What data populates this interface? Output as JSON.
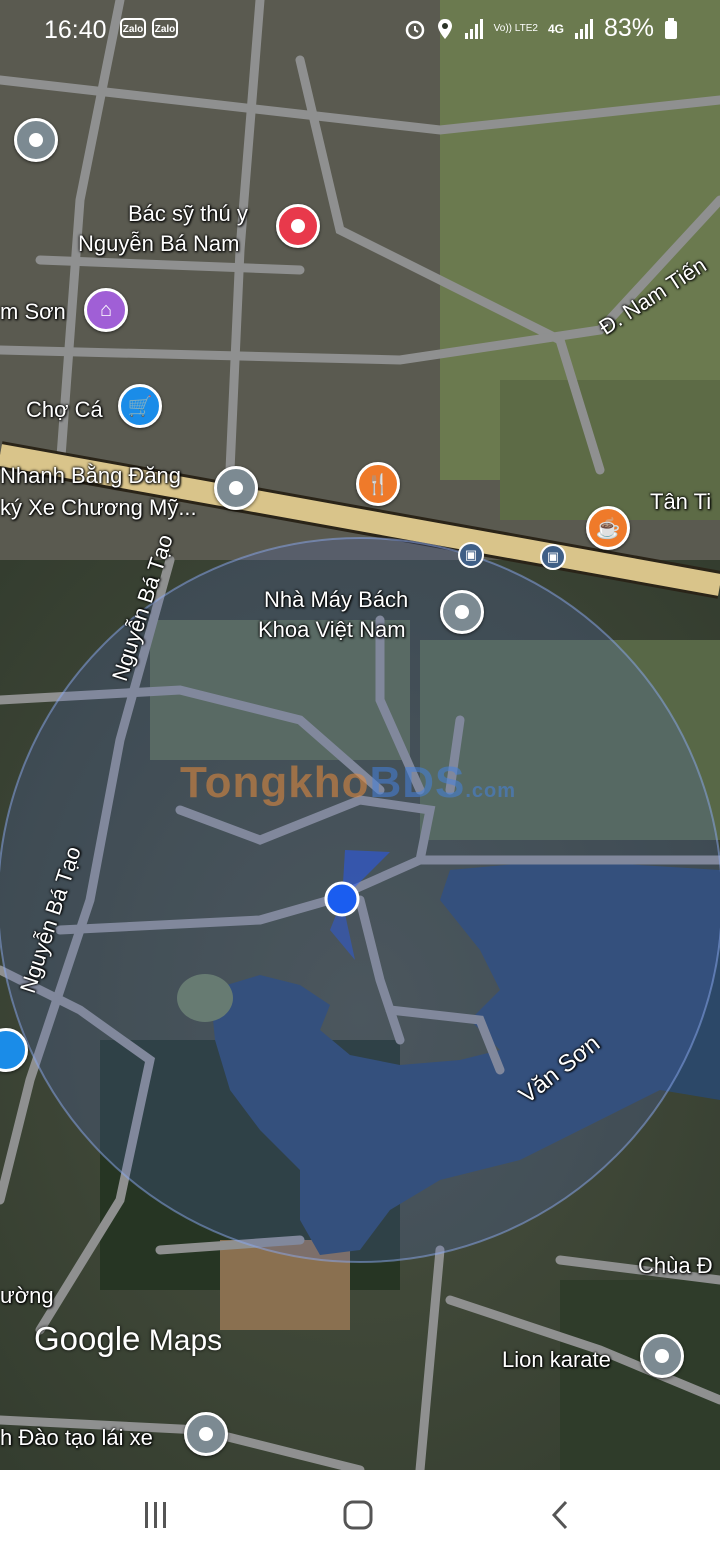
{
  "status_bar": {
    "time": "16:40",
    "notif_1": "Zalo",
    "notif_2": "Zalo",
    "network": "4G",
    "volte": "Vo)) LTE2",
    "battery": "83%",
    "icons": [
      "alarm-icon",
      "location-icon",
      "signal-icon",
      "battery-icon"
    ]
  },
  "map": {
    "labels": {
      "vet_line1": "Bác sỹ thú y",
      "vet_line2": "Nguyễn Bá Nam",
      "nam_son": "m Sơn",
      "cho_ca": "Chợ Cá",
      "nhanh_line1": "Nhanh Bằng Đăng",
      "nhanh_line2": "ký Xe Chương Mỹ...",
      "nam_tien": "Đ. Nam Tiến",
      "tan_ti": "Tân Ti",
      "factory_line1": "Nhà Máy Bách",
      "factory_line2": "Khoa Việt Nam",
      "road_1": "Nguyễn Bá Tạo",
      "road_2": "Nguyễn Bá Tạo",
      "van_son": "Văn Sơn",
      "chua": "Chùa Đ",
      "truong": "ường",
      "lion": "Lion karate",
      "dao_tao": "h Đào tạo lái xe"
    },
    "watermark_1": "Tongkho",
    "watermark_2": "BDS",
    "watermark_3": ".com",
    "attribution_1": "Google",
    "attribution_2": "Maps",
    "accent": "#1a5df0",
    "highway_color": "#d9c48a",
    "water_color": "#2c4868"
  },
  "nav_bar": {
    "buttons": [
      "recents-icon",
      "home-icon",
      "back-icon"
    ]
  }
}
